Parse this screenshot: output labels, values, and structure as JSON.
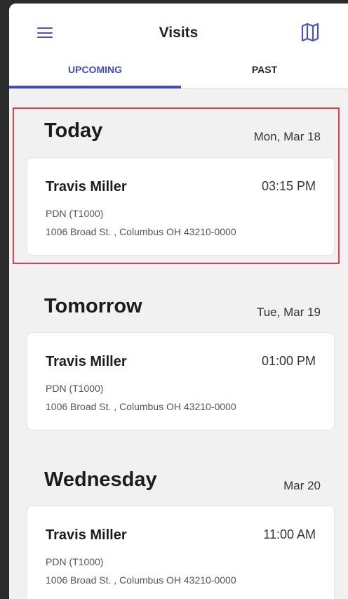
{
  "header": {
    "title": "Visits",
    "menu_icon": "hamburger-menu-icon",
    "map_icon": "map-icon",
    "accent_color": "#3f4bb5"
  },
  "tabs": [
    {
      "label": "UPCOMING",
      "active": true
    },
    {
      "label": "PAST",
      "active": false
    }
  ],
  "sections": [
    {
      "day": "Today",
      "date": "Mon, Mar 18",
      "visit": {
        "name": "Travis Miller",
        "time": "03:15 PM",
        "code": "PDN (T1000)",
        "address": "1006 Broad St. , Columbus OH 43210-0000"
      }
    },
    {
      "day": "Tomorrow",
      "date": "Tue, Mar 19",
      "visit": {
        "name": "Travis Miller",
        "time": "01:00 PM",
        "code": "PDN (T1000)",
        "address": "1006 Broad St. , Columbus OH 43210-0000"
      }
    },
    {
      "day": "Wednesday",
      "date": "Mar 20",
      "visit": {
        "name": "Travis Miller",
        "time": "11:00 AM",
        "code": "PDN (T1000)",
        "address": "1006 Broad St. , Columbus OH 43210-0000"
      }
    }
  ],
  "highlight_color": "#e5404a"
}
